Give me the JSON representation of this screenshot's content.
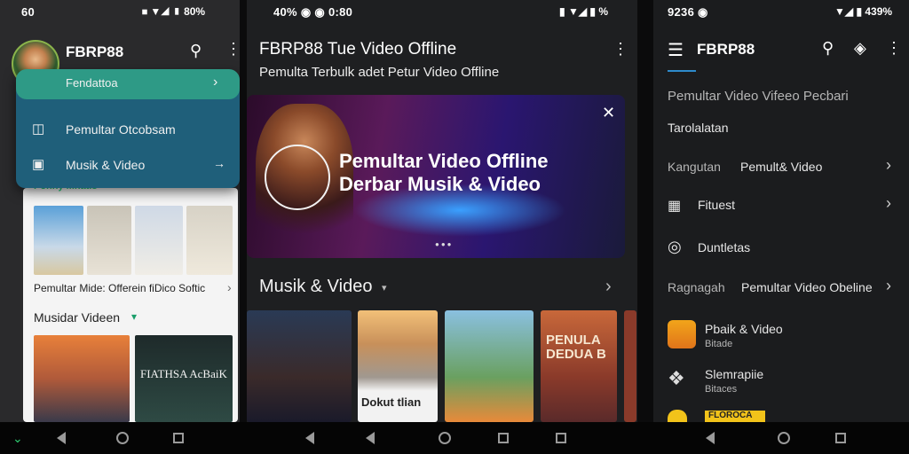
{
  "screen1": {
    "status_time": "60",
    "status_icons": "⏹ ▼◢ ▮ 80%",
    "app_title": "FBRP88",
    "menu": {
      "highlight": "Fendattoa",
      "item1": "Pemultar Otcobsam",
      "item2": "Musik & Video"
    },
    "section_hidden": "Ponny Mnatis",
    "card_caption": "Pemultar Mide: Offerein fiDico Softic",
    "section2": "Musidar Videen",
    "section2_arrow": "▾",
    "tile_text": "FIATHSA AcBaiK"
  },
  "screen2": {
    "status_left": "40% ◉ ◉ 0:80",
    "status_right": "▮ ▼◢ ▮ %",
    "title": "FBRP88 Tue Video Offline",
    "subtitle": "Pemulta Terbulk adet Petur Video Offline",
    "banner_line1": "Pemultar Video Offline",
    "banner_line2": "Derbar Musik & Video",
    "section": "Musik & Video",
    "section_arrow": "▾",
    "thumb_text1": "Dokut tlian",
    "thumb_text2": "PENULA DEDUA B"
  },
  "screen3": {
    "status_left": "9236 ◉",
    "status_right": "▼◢ ▮ 439%",
    "title": "FBRP88",
    "items": {
      "line1": "Pemultar Video Vifeeo Pecbari",
      "line2": "Tarolalatan",
      "row3_label": "Kangutan",
      "row3_value": "Pemult& Video",
      "row4": "Fituest",
      "row5": "Duntletas",
      "row6_label": "Ragnagah",
      "row6_value": "Pemultar Video Obeline",
      "app1_title": "Pbaik & Video",
      "app1_sub": "Bitade",
      "app2_title": "Slemrapiie",
      "app2_sub": "Bitaces",
      "app3_label": "FLOROCA"
    }
  },
  "colors": {
    "menu_bg": "#1f5f7a",
    "menu_highlight": "#2e9a86",
    "banner_purple": "#5a1a5a",
    "accent_green": "#2ecc71"
  }
}
